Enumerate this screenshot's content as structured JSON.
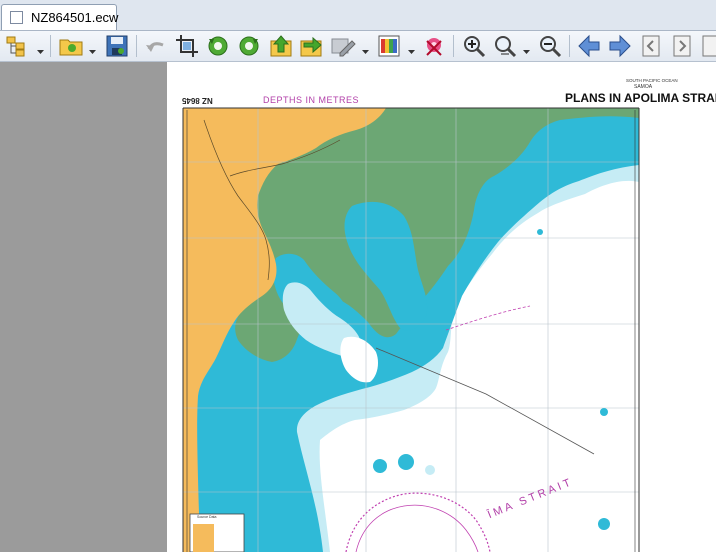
{
  "window": {
    "tab_title": "NZ864501.ecw"
  },
  "toolbar": {
    "icons": [
      "layers-icon",
      "open-folder-icon",
      "save-icon",
      "undo-icon",
      "crop-icon",
      "rotate-left-icon",
      "rotate-right-icon",
      "upload-icon",
      "send-icon",
      "edit-image-icon",
      "color-palette-icon",
      "remove-color-icon",
      "zoom-in-icon",
      "zoom-actual-icon",
      "zoom-out-icon",
      "back-arrow-icon",
      "forward-arrow-icon",
      "previous-page-icon",
      "next-page-icon",
      "page-icon"
    ]
  },
  "chart": {
    "chart_number": "NZ 8645",
    "depth_units": "DEPTHS  IN  METRES",
    "region_top": "SOUTH PACIFIC OCEAN",
    "country": "SAMOA",
    "title": "PLANS IN APOLIMA STRAIT",
    "strait_label": "ĪMA  STRAIT",
    "inset_label": "Source Data"
  },
  "colors": {
    "land": "#f5bb5c",
    "drying": "#6ca774",
    "shallow": "#2fb9d6",
    "medium": "#c3ebf4",
    "deep": "#ffffff",
    "magenta": "#c040b0"
  }
}
